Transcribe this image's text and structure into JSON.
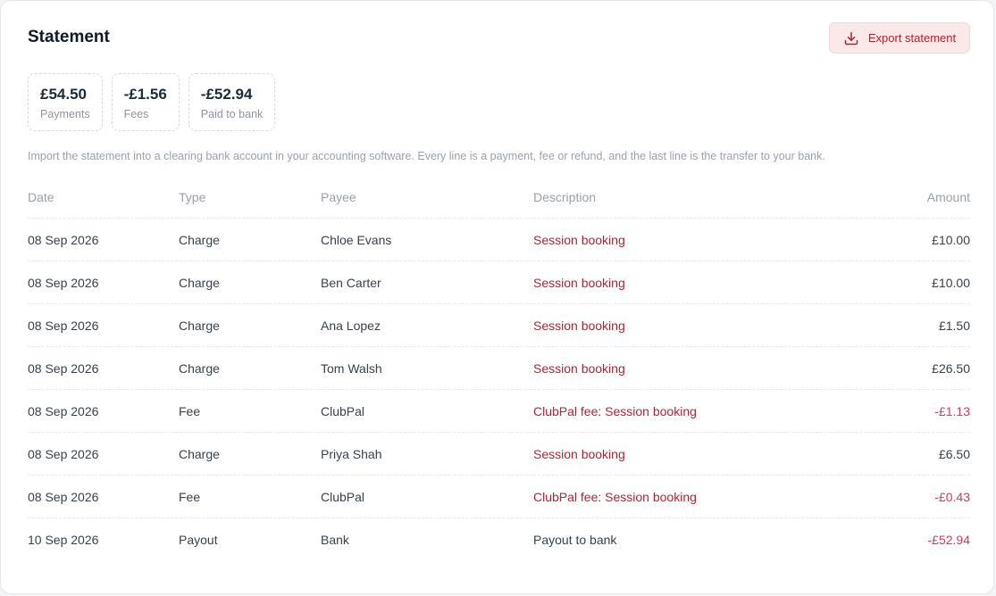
{
  "header": {
    "title": "Statement",
    "export_label": "Export statement"
  },
  "stats": [
    {
      "value": "£54.50",
      "label": "Payments"
    },
    {
      "value": "-£1.56",
      "label": "Fees"
    },
    {
      "value": "-£52.94",
      "label": "Paid to bank"
    }
  ],
  "note": "Import the statement into a clearing bank account in your accounting software. Every line is a payment, fee or refund, and the last line is the transfer to your bank.",
  "table": {
    "columns": {
      "date": "Date",
      "type": "Type",
      "payee": "Payee",
      "description": "Description",
      "amount": "Amount"
    },
    "rows": [
      {
        "date": "08 Sep 2026",
        "type": "Charge",
        "payee": "Chloe Evans",
        "description": "Session booking",
        "amount": "£10.00"
      },
      {
        "date": "08 Sep 2026",
        "type": "Charge",
        "payee": "Ben Carter",
        "description": "Session booking",
        "amount": "£10.00"
      },
      {
        "date": "08 Sep 2026",
        "type": "Charge",
        "payee": "Ana Lopez",
        "description": "Session booking",
        "amount": "£1.50"
      },
      {
        "date": "08 Sep 2026",
        "type": "Charge",
        "payee": "Tom Walsh",
        "description": "Session booking",
        "amount": "£26.50"
      },
      {
        "date": "08 Sep 2026",
        "type": "Fee",
        "payee": "ClubPal",
        "description": "ClubPal fee: Session booking",
        "amount": "-£1.13"
      },
      {
        "date": "08 Sep 2026",
        "type": "Charge",
        "payee": "Priya Shah",
        "description": "Session booking",
        "amount": "£6.50"
      },
      {
        "date": "08 Sep 2026",
        "type": "Fee",
        "payee": "ClubPal",
        "description": "ClubPal fee: Session booking",
        "amount": "-£0.43"
      },
      {
        "date": "10 Sep 2026",
        "type": "Payout",
        "payee": "Bank",
        "description": "Payout to bank",
        "amount": "-£52.94"
      }
    ]
  },
  "colors": {
    "accent": "#b4232f",
    "negative": "#e0365a",
    "button_bg": "#fbe9e9"
  },
  "icons": {
    "export": "download-icon"
  }
}
